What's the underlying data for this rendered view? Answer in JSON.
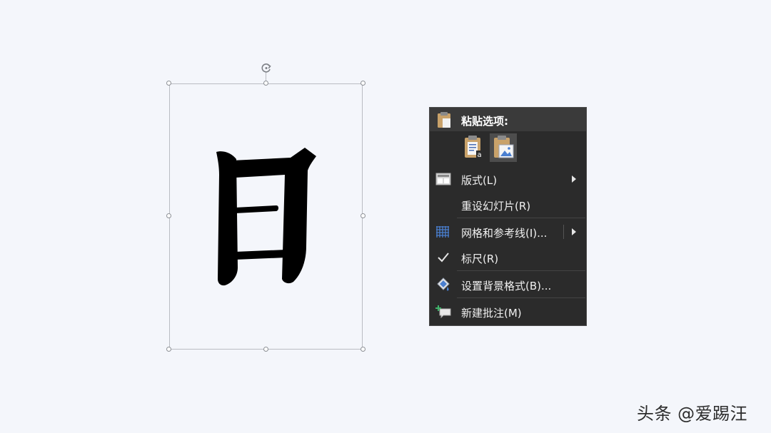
{
  "context_menu": {
    "header_title": "粘贴选项:",
    "paste_options": [
      {
        "icon": "paste-keep-text-icon"
      },
      {
        "icon": "paste-as-picture-icon"
      }
    ],
    "items": [
      {
        "label": "版式(L)",
        "icon": "layout-icon",
        "has_submenu": true
      },
      {
        "label": "重设幻灯片(R)",
        "icon": "",
        "has_submenu": false
      },
      {
        "label": "网格和参考线(I)...",
        "icon": "grid-icon",
        "has_submenu": true
      },
      {
        "label": "标尺(R)",
        "icon": "checkmark-icon",
        "has_submenu": false
      },
      {
        "label": "设置背景格式(B)...",
        "icon": "format-background-icon",
        "has_submenu": false
      },
      {
        "label": "新建批注(M)",
        "icon": "new-comment-icon",
        "has_submenu": false
      }
    ]
  },
  "slide": {
    "image_glyph": "日"
  },
  "watermark": "头条 @爱踢汪",
  "colors": {
    "slide_bg": "#f4f6fb",
    "menu_bg": "#2b2b2b",
    "menu_header_bg": "#3a3a3a",
    "menu_text": "#f0f0f0",
    "grid_icon": "#4a7fd0"
  }
}
